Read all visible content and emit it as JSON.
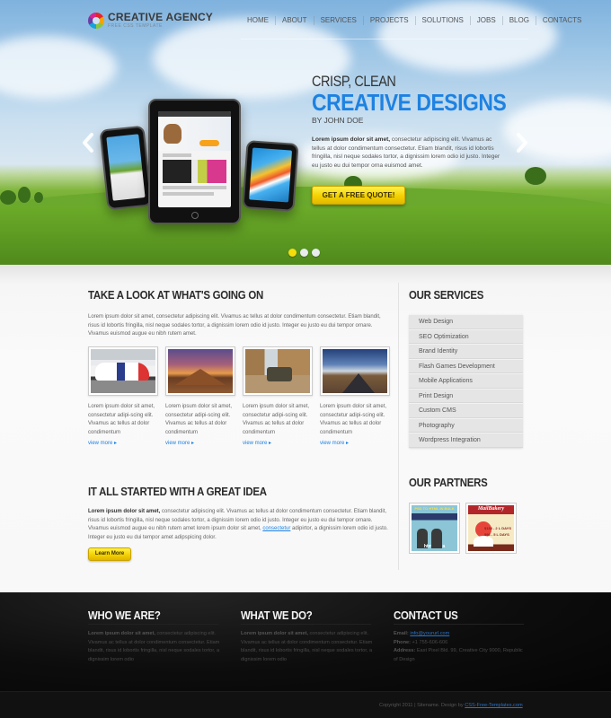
{
  "brand": {
    "title": "CREATIVE AGENCY",
    "tagline": "FREE CSS TEMPLATE"
  },
  "nav": {
    "items": [
      "HOME",
      "ABOUT",
      "SERVICES",
      "PROJECTS",
      "SOLUTIONS",
      "JOBS",
      "BLOG",
      "CONTACTS"
    ]
  },
  "hero": {
    "kicker": "CRISP, CLEAN",
    "title": "CREATIVE DESIGNS",
    "byline": "BY JOHN DOE",
    "text_bold": "Lorem ipsum dolor sit amet,",
    "text": " consectetur adipiscing elit. Vivamus ac tellus at dolor condimentum consectetur. Etiam blandit, risus id lobortis fringilla, nisl neque sodales tortor, a dignissim lorem odio id justo. Integer eu justo eu dui tempor orna euismod amet.",
    "cta_label": "GET A FREE QUOTE!",
    "prev_icon": "chevron-left",
    "next_icon": "chevron-right",
    "slides": {
      "count": 3,
      "active": 1
    }
  },
  "whats_going_on": {
    "title": "TAKE A LOOK AT WHAT'S GOING ON",
    "text": "Lorem ipsum dolor sit amet, consectetur adipiscing elit. Vivamus ac tellus at dolor condimentum consectetur. Etiam blandit, risus id lobortis fringilla, nisl neque sodales tortor, a dignissim lorem odio id justo. Integer eu justo eu dui tempor ornare. Vivamus euismod augue eu nibh rutem amet.",
    "items": [
      {
        "image": "race-car-photo",
        "text": "Lorem ipsum dolor sit amet, consectetur adipi-scing elit. Vivamus ac tellus at dolor condimentum",
        "link": "view more ▸"
      },
      {
        "image": "desert-sunset-photo",
        "text": "Lorem ipsum dolor sit amet, consectetur adipi-scing elit. Vivamus ac tellus at dolor condimentum",
        "link": "view more ▸"
      },
      {
        "image": "canyon-suv-photo",
        "text": "Lorem ipsum dolor sit amet, consectetur adipi-scing elit. Vivamus ac tellus at dolor condimentum",
        "link": "view more ▸"
      },
      {
        "image": "desert-road-rainbow-photo",
        "text": "Lorem ipsum dolor sit amet, consectetur adipi-scing elit. Vivamus ac tellus at dolor condimentum",
        "link": "view more ▸"
      }
    ]
  },
  "great_idea": {
    "title": "IT ALL STARTED WITH A GREAT IDEA",
    "text_bold": "Lorem ipsum dolor sit amet,",
    "text_before_link": " consectetur adipiscing elit. Vivamus ac tellus at dolor condimentum consectetur. Etiam blandit, risus id lobortis fringilla, nisl neque sodales tortor, a dignissim lorem odio id justo. Integer eu justo eu dui tempor ornare. Vivamus euismod augue eu nibh rutem amet lorem ipsum dolor sit amet, ",
    "link": "consectetur",
    "text_after_link": " adipirtor, a dignissim lorem odio id justo. Integer eu justo eu dui tempor amet adipspicing dolor.",
    "button_label": "Learn More"
  },
  "services": {
    "title": "OUR SERVICES",
    "items": [
      "Web Design",
      "SEO Optimization",
      "Brand Identity",
      "Flash Games Development",
      "Mobile Applications",
      "Print Design",
      "Custom CMS",
      "Photography",
      "Wordpress Integration"
    ]
  },
  "partners": {
    "title": "OUR PARTNERS",
    "items": [
      {
        "name": "htmlMafia",
        "headline": "PSD TO HTML IN BULK"
      },
      {
        "name": "MailBakery",
        "headline": "MailBakery",
        "prices": [
          "$138 - 2 L DAYS",
          "$98 - 5 L DAYS"
        ]
      }
    ]
  },
  "footer": {
    "who": {
      "title": "WHO WE ARE?",
      "text_bold": "Lorem ipsum dolor sit amet,",
      "text": " consectetur adipiscing elit. Vivamus ac tellus at dolor condimentum consectetur. Etiam blandit, risus id lobortis fringilla, nisl neque sodales tortor, a dignissim lorem odio"
    },
    "what": {
      "title": "WHAT WE DO?",
      "text_bold": "Lorem ipsum dolor sit amet,",
      "text": " consectetur adipiscing elit. Vivamus ac tellus at dolor condimentum consectetur. Etiam blandit, risus id lobortis fringilla, nisl neque sodales tortor, a dignissim lorem odio"
    },
    "contact": {
      "title": "CONTACT US",
      "email_label": "Email:",
      "email": "info@yoururl.com",
      "phone_label": "Phone:",
      "phone": "+1 755-606-606",
      "address_label": "Address:",
      "address": "East Pixel Bld. 99, Creative City 9000, Republic of Design"
    },
    "copyright": "Copyright 2011   |   Sitename. Design by ",
    "credit_link": "CSS-Free-Templates.com"
  }
}
